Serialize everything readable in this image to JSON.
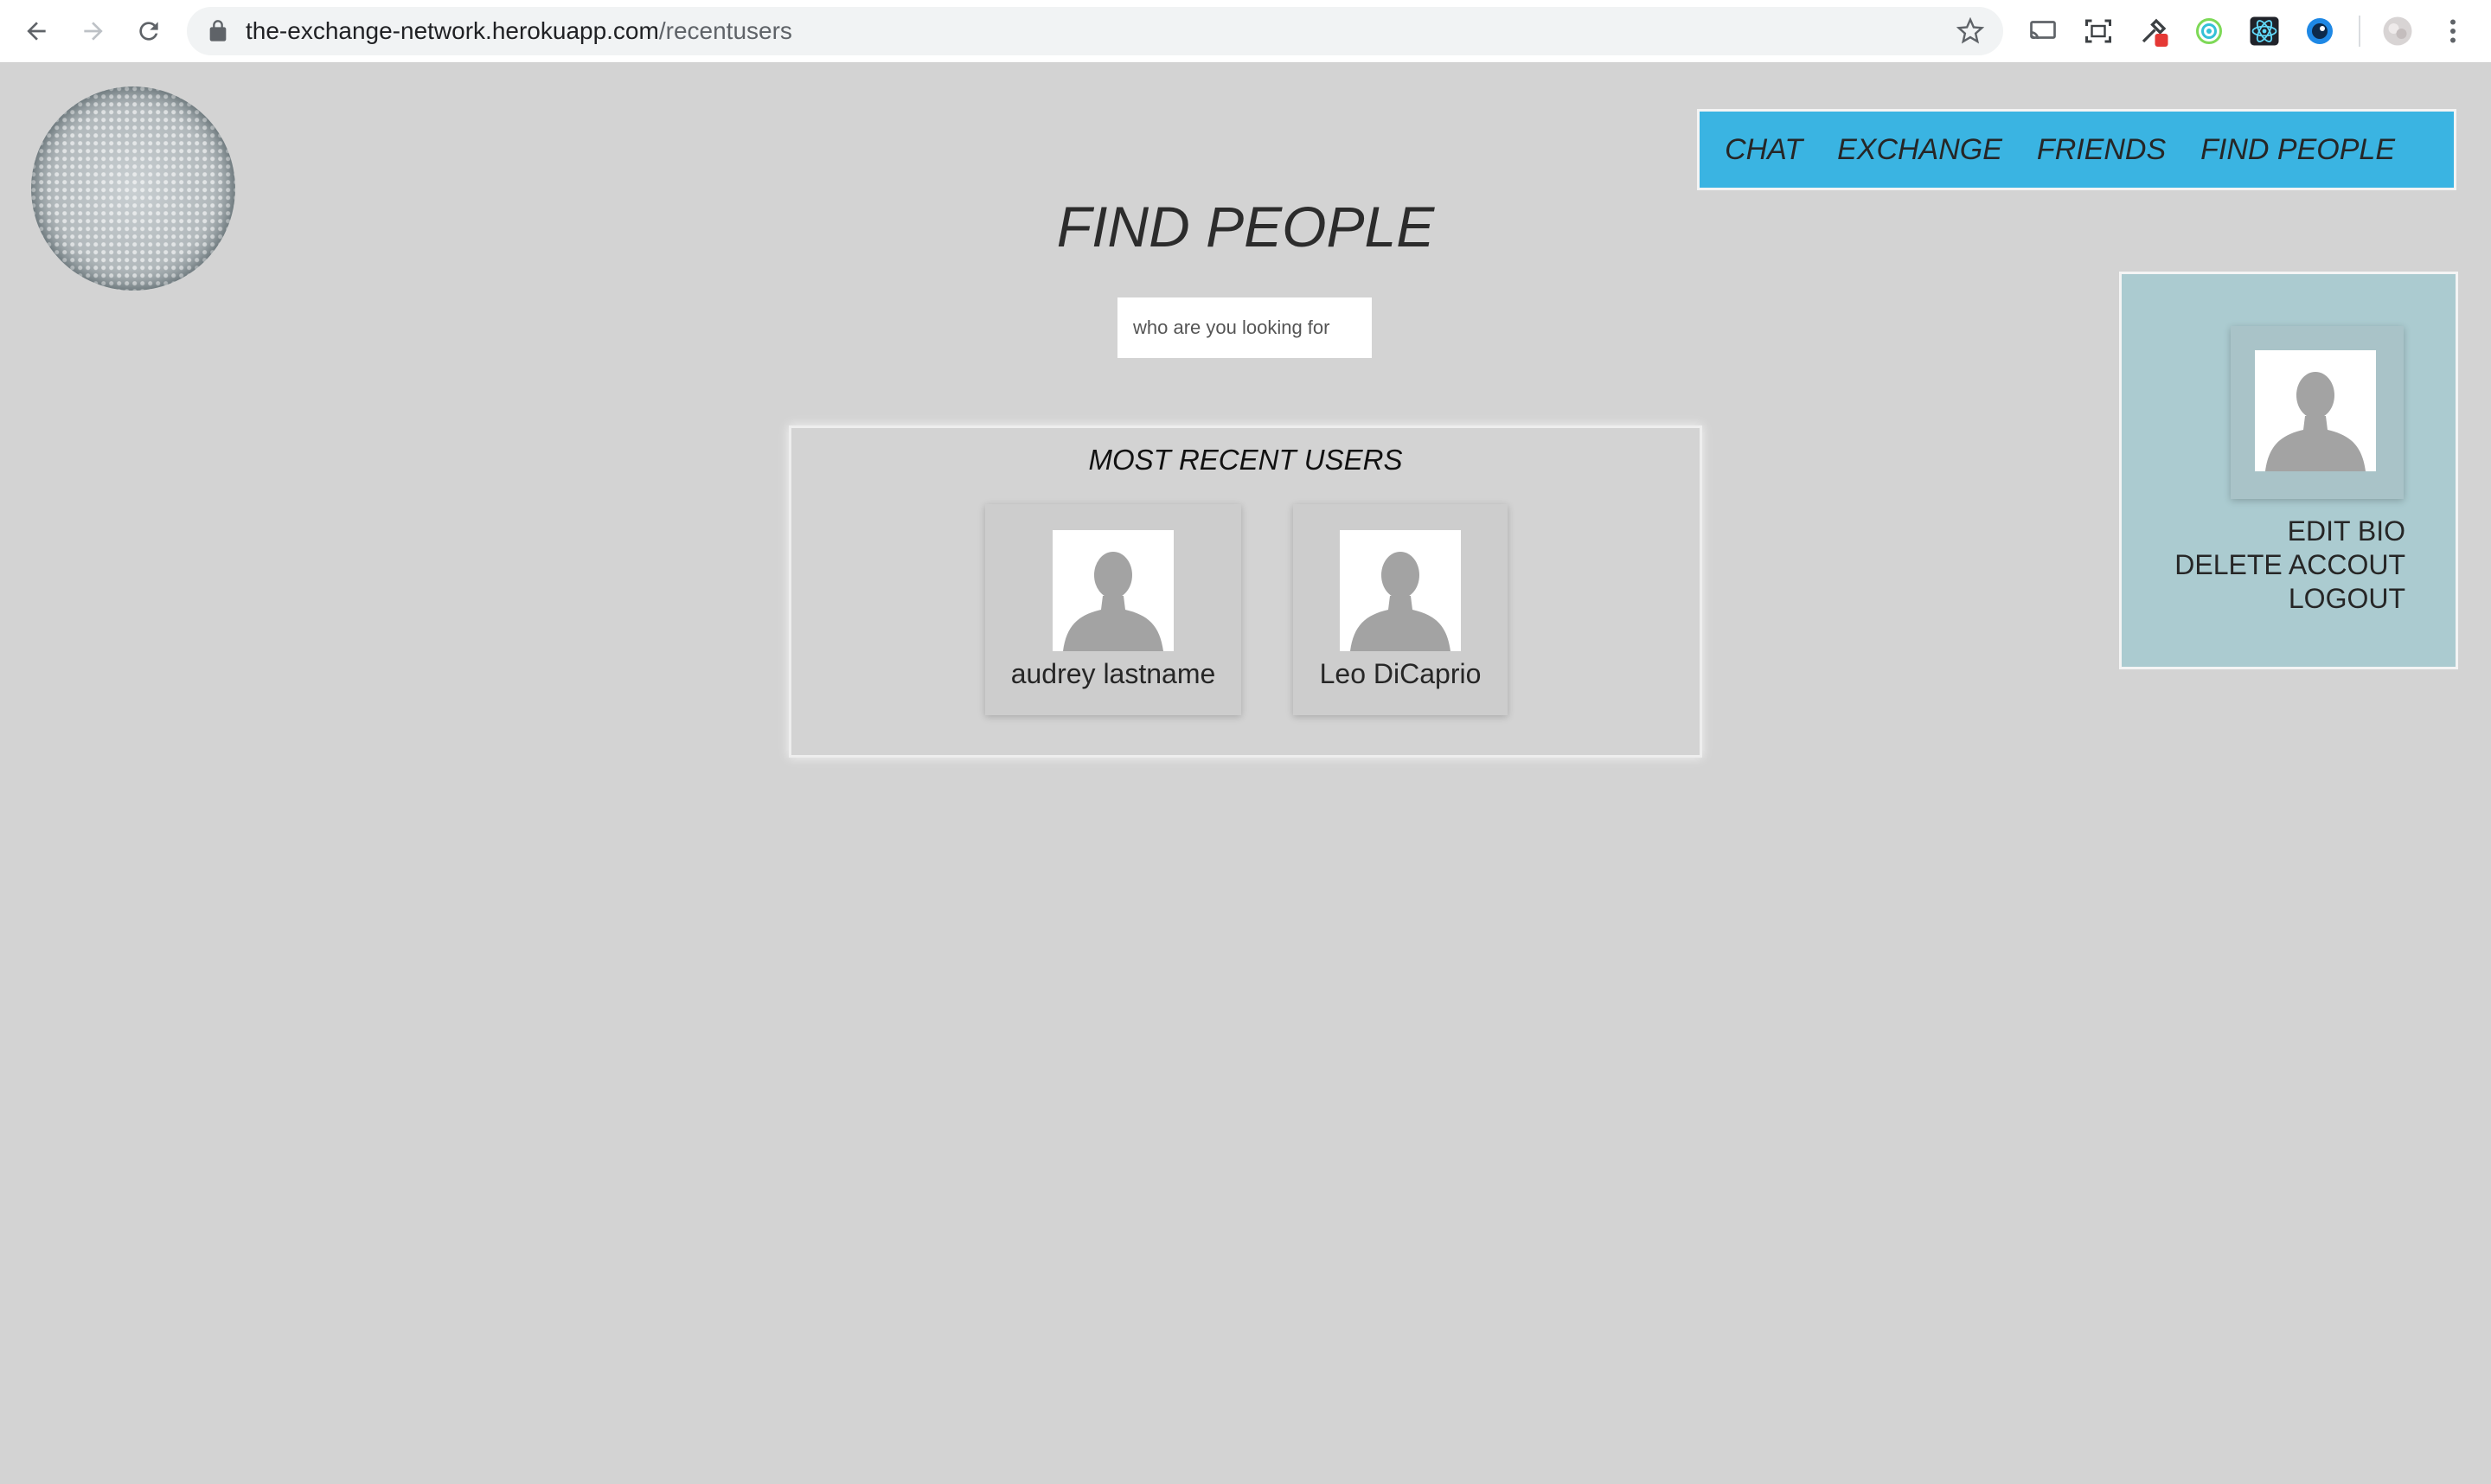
{
  "browser": {
    "url_host": "the-exchange-network.herokuapp.com",
    "url_path": "/recentusers"
  },
  "nav": {
    "items": [
      {
        "label": "CHAT"
      },
      {
        "label": "EXCHANGE"
      },
      {
        "label": "FRIENDS"
      },
      {
        "label": "FIND PEOPLE"
      }
    ]
  },
  "page": {
    "title": "FIND PEOPLE",
    "search": {
      "placeholder": "who are you looking for",
      "value": ""
    }
  },
  "recent_users": {
    "title": "MOST RECENT USERS",
    "users": [
      {
        "name": "audrey lastname"
      },
      {
        "name": "Leo DiCaprio"
      }
    ]
  },
  "profile_panel": {
    "links": [
      {
        "label": "EDIT BIO"
      },
      {
        "label": "DELETE ACCOUT"
      },
      {
        "label": "LOGOUT"
      }
    ]
  },
  "colors": {
    "page_bg": "#d3d3d3",
    "nav_bg": "#3ab4e2",
    "panel_bg": "#abcbd0"
  }
}
